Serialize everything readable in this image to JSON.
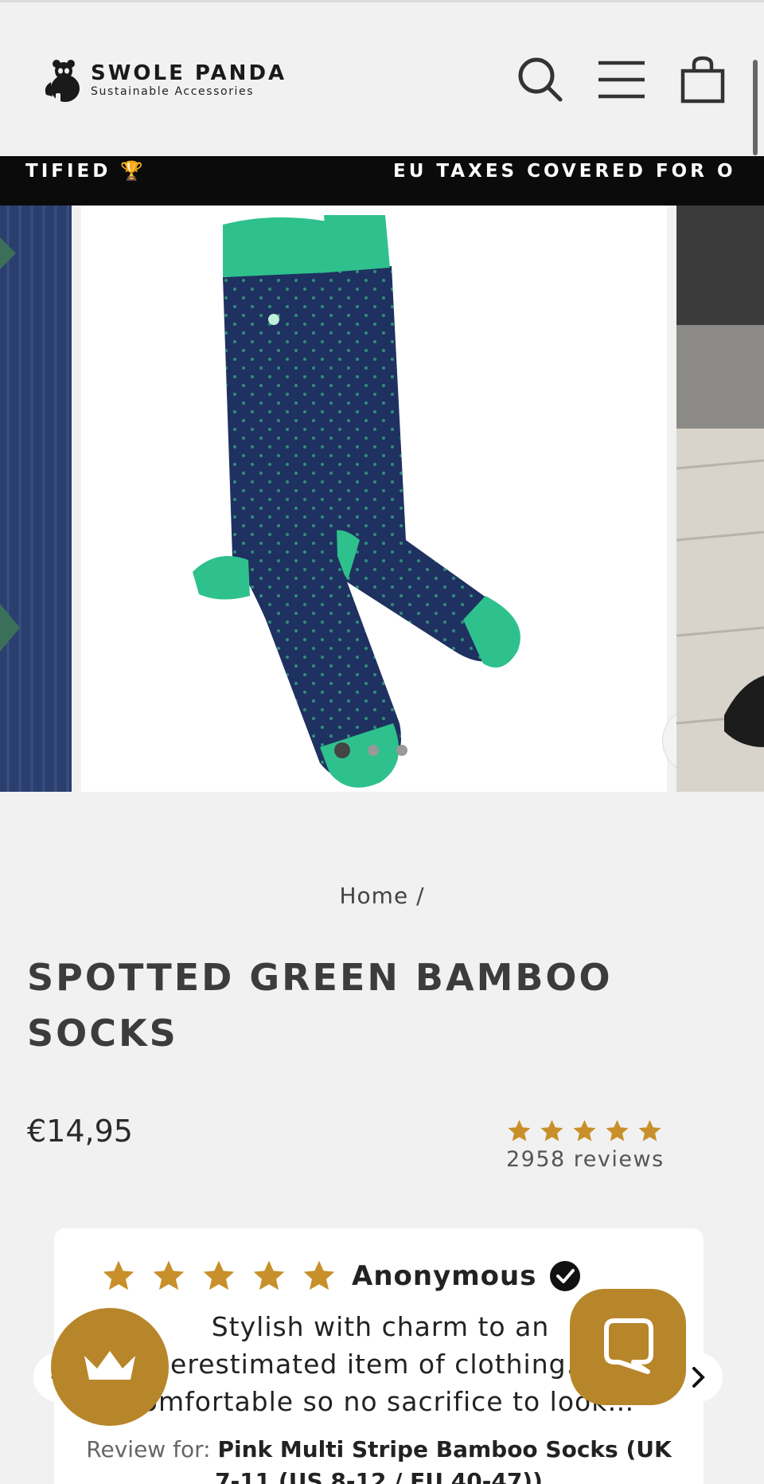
{
  "header": {
    "brand_name": "SWOLE PANDA",
    "brand_tagline": "Sustainable Accessories",
    "icons": [
      "search-icon",
      "menu-icon",
      "cart-icon"
    ]
  },
  "announcement": {
    "item1": "TIFIED 🏆",
    "item2": "EU TAXES COVERED FOR O"
  },
  "gallery": {
    "slide_count": 3,
    "active_slide": 1,
    "zoom_icon": "zoom-icon"
  },
  "product": {
    "breadcrumb": "Home /",
    "title": "SPOTTED GREEN BAMBOO SOCKS",
    "price": "€14,95",
    "rating_stars": 5,
    "review_count": "2958 reviews"
  },
  "review": {
    "stars": 5,
    "author": "Anonymous",
    "text": "Stylish with charm to an underestimated item of clothing. Also comfortable so no sacrifice to look…",
    "for_label": "Review for: ",
    "for_product": "Pink Multi Stripe Bamboo Socks (UK 7-11 (US 8-12 / EU 40-47))"
  },
  "colors": {
    "accent_gold": "#b7862a",
    "star_gold": "#c8902a",
    "sock_navy": "#1f3160",
    "sock_green": "#2fc18d",
    "background": "#f1f1f1"
  }
}
